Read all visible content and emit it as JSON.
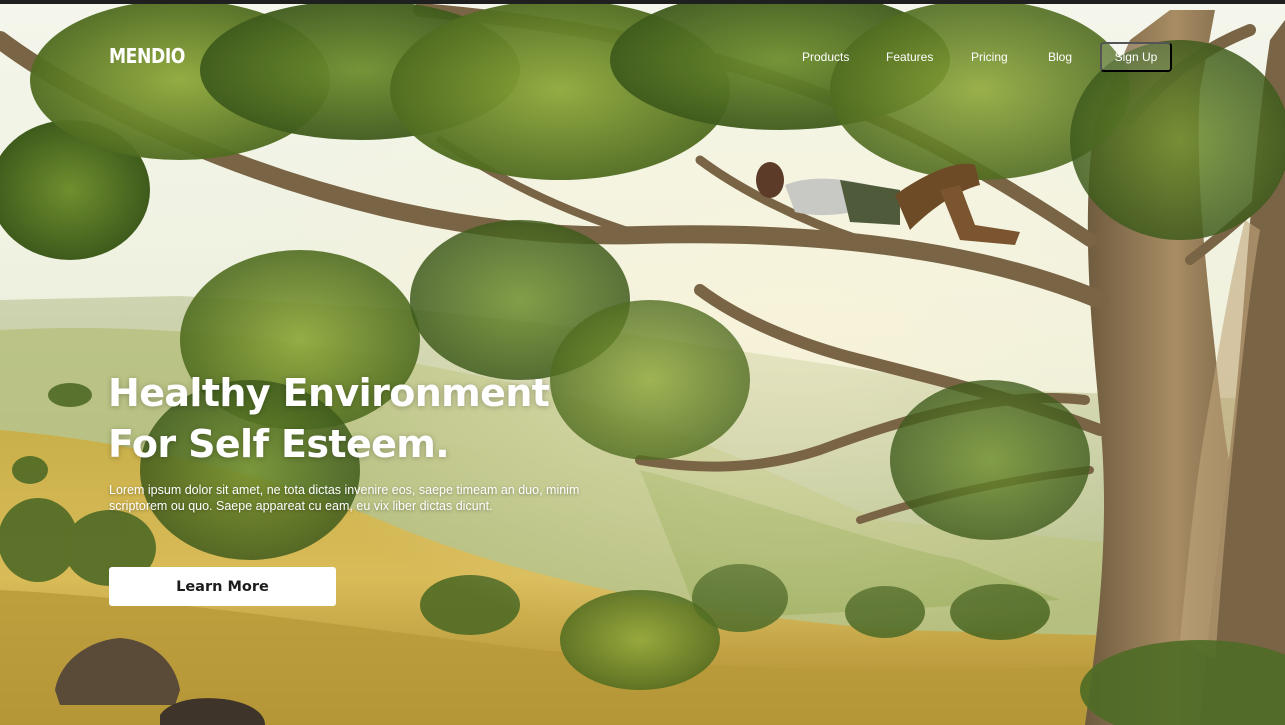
{
  "brand": {
    "logo_text": "MENDIO"
  },
  "nav": {
    "items": [
      {
        "label": "Products"
      },
      {
        "label": "Features"
      },
      {
        "label": "Pricing"
      },
      {
        "label": "Blog"
      }
    ],
    "signup_label": "Sign Up"
  },
  "hero": {
    "headline_line1": "Healthy Environment",
    "headline_line2": "For Self Esteem.",
    "body": "Lorem ipsum dolor sit amet, ne tota dictas invenire eos, saepe timeam an duo, minim scriptorem ou quo. Saepe appareat cu eam, eu vix liber dictas dicunt.",
    "cta_label": "Learn More"
  },
  "colors": {
    "text": "#ffffff",
    "cta_background": "#ffffff",
    "cta_text": "#1d1d1d"
  }
}
